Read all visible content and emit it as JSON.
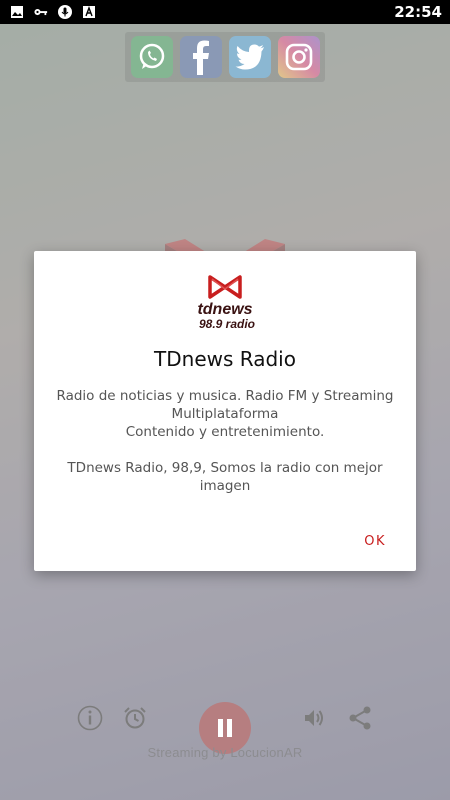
{
  "status_bar": {
    "time": "22:54",
    "icons": [
      "image-icon",
      "key-icon",
      "microphone-icon",
      "text-a-icon"
    ]
  },
  "social_icons": [
    "whatsapp-icon",
    "facebook-icon",
    "twitter-icon",
    "instagram-icon"
  ],
  "controls": {
    "icons": [
      "info-icon",
      "alarm-icon",
      "pause-icon",
      "volume-icon",
      "share-icon"
    ],
    "accent_color": "#7a1418"
  },
  "footer": {
    "streaming_text": "Streaming by LocucionAR"
  },
  "dialog": {
    "logo_text_top": "tdnews",
    "logo_text_bottom": "98.9 radio",
    "title": "TDnews Radio",
    "message_line1": "Radio de noticias y musica. Radio FM y Streaming Multiplataforma",
    "message_line2": "Contenido y entretenimiento.",
    "message_line3": "TDnews Radio, 98,9, Somos la radio con mejor imagen",
    "ok_label": "OK",
    "ok_color": "#c81e1e"
  }
}
